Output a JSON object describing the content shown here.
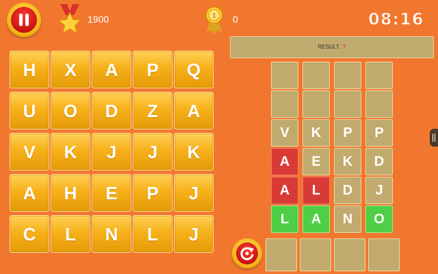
{
  "hud": {
    "score": "1900",
    "bonus": "0",
    "timer": "08:16"
  },
  "result": {
    "label": "RESULT:",
    "value": "?"
  },
  "letter_grid": {
    "rows": [
      [
        "H",
        "X",
        "A",
        "P",
        "Q"
      ],
      [
        "U",
        "O",
        "D",
        "Z",
        "A"
      ],
      [
        "V",
        "K",
        "J",
        "J",
        "K"
      ],
      [
        "A",
        "H",
        "E",
        "P",
        "J"
      ],
      [
        "C",
        "L",
        "N",
        "L",
        "J"
      ]
    ]
  },
  "word_board": {
    "rows": [
      [
        {
          "letter": "",
          "status": "empty"
        },
        {
          "letter": "",
          "status": "empty"
        },
        {
          "letter": "",
          "status": "empty"
        },
        {
          "letter": "",
          "status": "empty"
        }
      ],
      [
        {
          "letter": "",
          "status": "empty"
        },
        {
          "letter": "",
          "status": "empty"
        },
        {
          "letter": "",
          "status": "empty"
        },
        {
          "letter": "",
          "status": "empty"
        }
      ],
      [
        {
          "letter": "V",
          "status": "neutral"
        },
        {
          "letter": "K",
          "status": "neutral"
        },
        {
          "letter": "P",
          "status": "neutral"
        },
        {
          "letter": "P",
          "status": "neutral"
        }
      ],
      [
        {
          "letter": "A",
          "status": "red"
        },
        {
          "letter": "E",
          "status": "neutral"
        },
        {
          "letter": "K",
          "status": "neutral"
        },
        {
          "letter": "D",
          "status": "neutral"
        }
      ],
      [
        {
          "letter": "A",
          "status": "red"
        },
        {
          "letter": "L",
          "status": "red"
        },
        {
          "letter": "D",
          "status": "neutral"
        },
        {
          "letter": "J",
          "status": "neutral"
        }
      ],
      [
        {
          "letter": "L",
          "status": "green"
        },
        {
          "letter": "A",
          "status": "green"
        },
        {
          "letter": "N",
          "status": "neutral"
        },
        {
          "letter": "O",
          "status": "green"
        }
      ]
    ]
  },
  "input_slots": [
    "",
    "",
    "",
    ""
  ],
  "icons": {
    "pause": "pause-icon",
    "score": "star-medal-icon",
    "bonus": "award-ribbon-icon",
    "reset": "reset-icon"
  },
  "colors": {
    "background": "#f2772e",
    "tile_gold": "#f7b11a",
    "cell_neutral": "#c1aa6e",
    "cell_red": "#d83b35",
    "cell_green": "#4fcf45"
  }
}
